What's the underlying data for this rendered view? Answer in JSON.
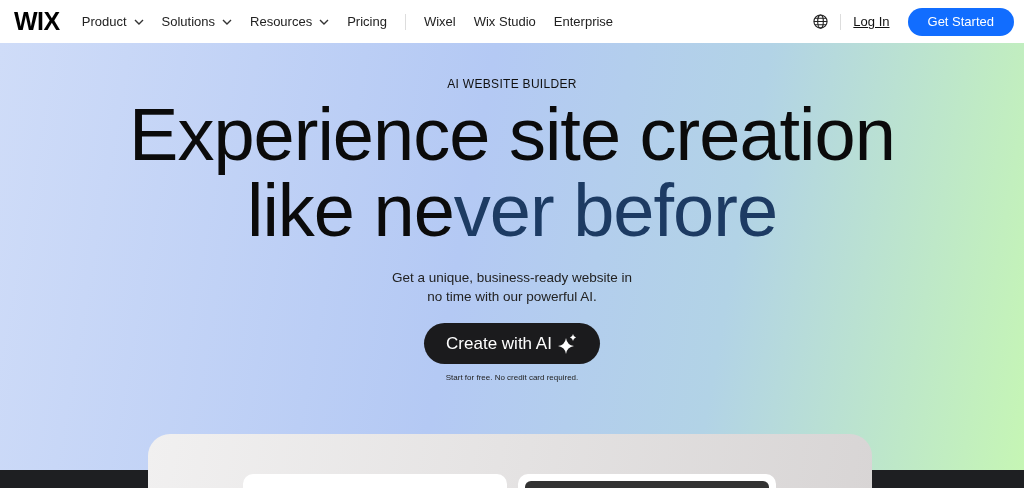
{
  "nav": {
    "logo": "WIX",
    "menu": [
      {
        "label": "Product",
        "dropdown": true
      },
      {
        "label": "Solutions",
        "dropdown": true
      },
      {
        "label": "Resources",
        "dropdown": true
      },
      {
        "label": "Pricing",
        "dropdown": false
      }
    ],
    "links": [
      "Wixel",
      "Wix Studio",
      "Enterprise"
    ],
    "login": "Log In",
    "cta": "Get Started"
  },
  "hero": {
    "eyebrow": "AI WEBSITE BUILDER",
    "headline_line1": "Experience site creation",
    "headline_line2": {
      "plain": "like ne",
      "tinted": "ver before"
    },
    "subtitle": "Get a unique, business-ready website in no time with our powerful AI.",
    "button": "Create with AI",
    "note": "Start for free. No credit card required."
  }
}
